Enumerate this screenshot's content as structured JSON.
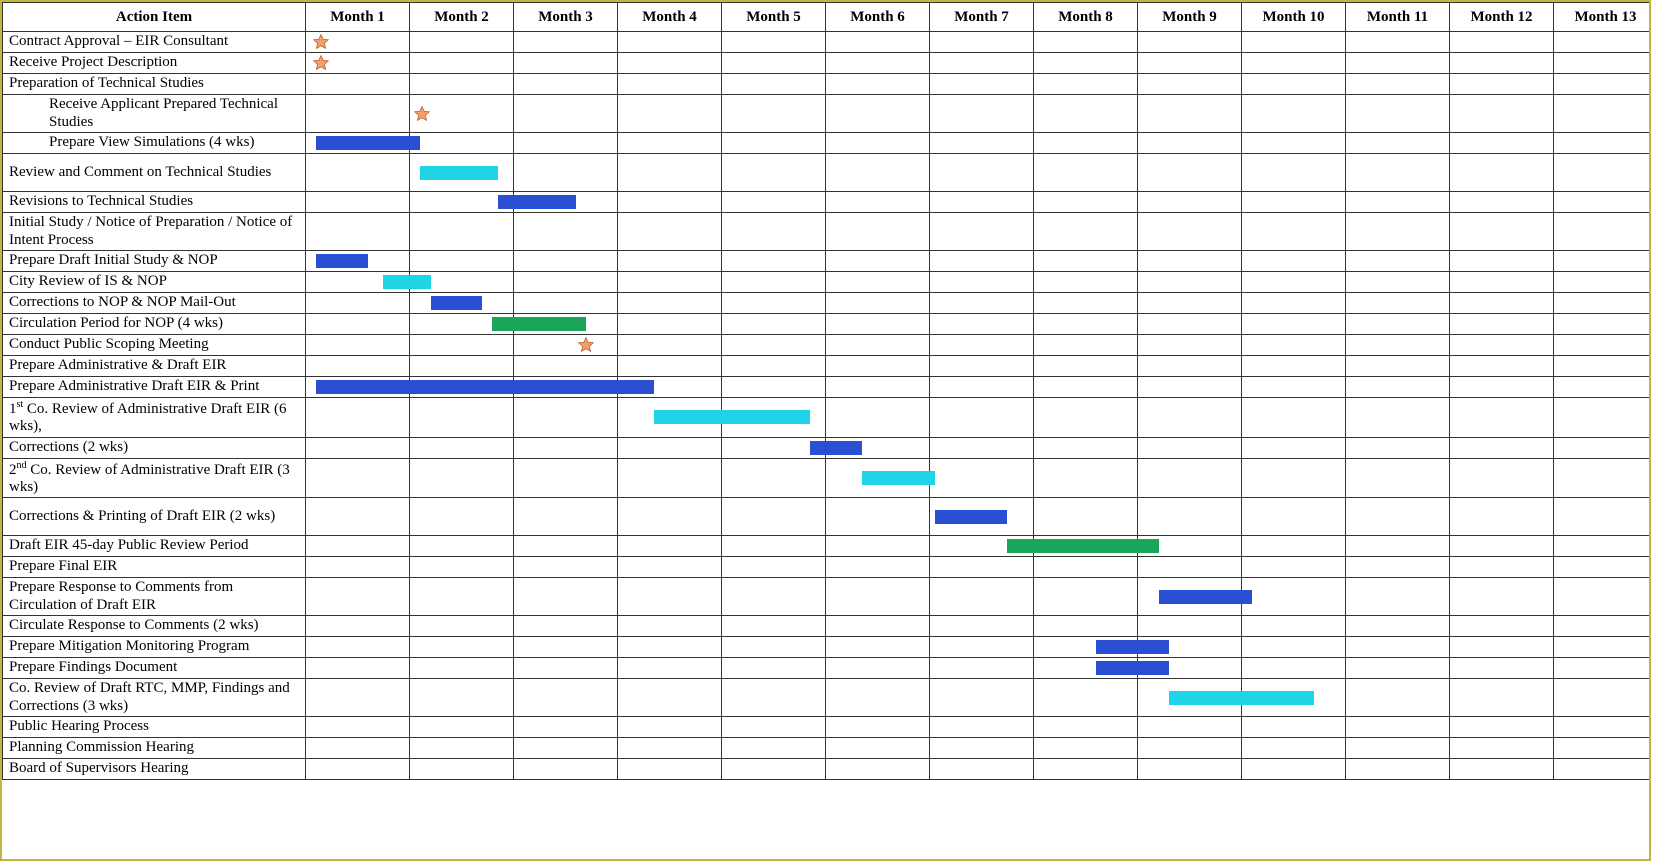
{
  "header": {
    "action": "Action Item",
    "months": [
      "Month 1",
      "Month 2",
      "Month 3",
      "Month 4",
      "Month 5",
      "Month 6",
      "Month 7",
      "Month 8",
      "Month 9",
      "Month 10",
      "Month 11",
      "Month 12",
      "Month 13"
    ]
  },
  "rows": [
    {
      "label": "Contract Approval – EIR Consultant",
      "h": 1,
      "marks": [
        {
          "type": "star",
          "col": 0,
          "pos": 0.15
        }
      ]
    },
    {
      "label": "Receive Project Description",
      "h": 1,
      "marks": [
        {
          "type": "star",
          "col": 0,
          "pos": 0.15
        }
      ]
    },
    {
      "label": "Preparation of Technical Studies",
      "h": 1,
      "marks": []
    },
    {
      "label": "Receive Applicant Prepared Technical Studies",
      "indent": true,
      "h": 2,
      "marks": [
        {
          "type": "star",
          "col": 1,
          "pos": 0.12
        }
      ]
    },
    {
      "label": "Prepare View Simulations (4 wks)",
      "indent": true,
      "h": 1,
      "marks": [
        {
          "type": "bar",
          "color": "blue",
          "startCol": 0,
          "startFrac": 0.1,
          "endCol": 1,
          "endFrac": 0.1
        }
      ]
    },
    {
      "label": "Review and Comment on Technical Studies",
      "h": 2,
      "marks": [
        {
          "type": "bar",
          "color": "cyan",
          "startCol": 1,
          "startFrac": 0.1,
          "endCol": 1,
          "endFrac": 0.85
        }
      ]
    },
    {
      "label": "Revisions to Technical Studies",
      "h": 1,
      "marks": [
        {
          "type": "bar",
          "color": "blue",
          "startCol": 1,
          "startFrac": 0.85,
          "endCol": 2,
          "endFrac": 0.6
        }
      ]
    },
    {
      "label": "Initial Study / Notice of Preparation / Notice of Intent Process",
      "h": 2,
      "marks": []
    },
    {
      "label": "Prepare Draft Initial Study & NOP",
      "h": 1,
      "marks": [
        {
          "type": "bar",
          "color": "blue",
          "startCol": 0,
          "startFrac": 0.1,
          "endCol": 0,
          "endFrac": 0.6
        }
      ]
    },
    {
      "label": "City Review of IS & NOP",
      "h": 1,
      "marks": [
        {
          "type": "bar",
          "color": "cyan",
          "startCol": 0,
          "startFrac": 0.75,
          "endCol": 1,
          "endFrac": 0.2
        }
      ]
    },
    {
      "label": "Corrections to NOP & NOP Mail-Out",
      "h": 1,
      "marks": [
        {
          "type": "bar",
          "color": "blue",
          "startCol": 1,
          "startFrac": 0.2,
          "endCol": 1,
          "endFrac": 0.7
        }
      ]
    },
    {
      "label": "Circulation Period for NOP  (4 wks)",
      "h": 1,
      "marks": [
        {
          "type": "bar",
          "color": "green",
          "startCol": 1,
          "startFrac": 0.8,
          "endCol": 2,
          "endFrac": 0.7
        }
      ]
    },
    {
      "label": "Conduct Public Scoping Meeting",
      "h": 1,
      "marks": [
        {
          "type": "star",
          "col": 2,
          "pos": 0.7
        }
      ]
    },
    {
      "label": "Prepare Administrative & Draft EIR",
      "h": 1,
      "marks": []
    },
    {
      "label": "Prepare Administrative Draft EIR & Print",
      "h": 1,
      "marks": [
        {
          "type": "bar",
          "color": "blue",
          "startCol": 0,
          "startFrac": 0.1,
          "endCol": 3,
          "endFrac": 0.35
        }
      ]
    },
    {
      "label": "1<sup>st</sup> Co. Review of Administrative Draft EIR (6 wks),",
      "h": 2,
      "html": true,
      "marks": [
        {
          "type": "bar",
          "color": "cyan",
          "startCol": 3,
          "startFrac": 0.35,
          "endCol": 4,
          "endFrac": 0.85
        }
      ]
    },
    {
      "label": "Corrections (2 wks)",
      "h": 1,
      "marks": [
        {
          "type": "bar",
          "color": "blue",
          "startCol": 4,
          "startFrac": 0.85,
          "endCol": 5,
          "endFrac": 0.35
        }
      ]
    },
    {
      "label": "2<sup>nd</sup> Co. Review of Administrative Draft EIR (3 wks)",
      "h": 2,
      "html": true,
      "marks": [
        {
          "type": "bar",
          "color": "cyan",
          "startCol": 5,
          "startFrac": 0.35,
          "endCol": 6,
          "endFrac": 0.05
        }
      ]
    },
    {
      "label": "Corrections & Printing of Draft EIR (2 wks)",
      "h": 2,
      "marks": [
        {
          "type": "bar",
          "color": "blue",
          "startCol": 6,
          "startFrac": 0.05,
          "endCol": 6,
          "endFrac": 0.75
        }
      ]
    },
    {
      "label": "Draft EIR 45-day Public Review Period",
      "h": 1,
      "marks": [
        {
          "type": "bar",
          "color": "green",
          "startCol": 6,
          "startFrac": 0.75,
          "endCol": 8,
          "endFrac": 0.2
        }
      ]
    },
    {
      "label": "Prepare Final EIR",
      "h": 1,
      "marks": []
    },
    {
      "label": "Prepare Response to Comments from Circulation of Draft EIR",
      "h": 2,
      "marks": [
        {
          "type": "bar",
          "color": "blue",
          "startCol": 8,
          "startFrac": 0.2,
          "endCol": 9,
          "endFrac": 0.1
        }
      ]
    },
    {
      "label": "Circulate Response to Comments (2 wks)",
      "h": 1,
      "marks": []
    },
    {
      "label": "Prepare Mitigation Monitoring Program",
      "h": 1,
      "marks": [
        {
          "type": "bar",
          "color": "blue",
          "startCol": 7,
          "startFrac": 0.6,
          "endCol": 8,
          "endFrac": 0.3
        }
      ]
    },
    {
      "label": "Prepare Findings Document",
      "h": 1,
      "marks": [
        {
          "type": "bar",
          "color": "blue",
          "startCol": 7,
          "startFrac": 0.6,
          "endCol": 8,
          "endFrac": 0.3
        }
      ]
    },
    {
      "label": "Co. Review of Draft RTC, MMP, Findings and Corrections (3 wks)",
      "h": 2,
      "marks": [
        {
          "type": "bar",
          "color": "cyan",
          "startCol": 8,
          "startFrac": 0.3,
          "endCol": 9,
          "endFrac": 0.7
        }
      ]
    },
    {
      "label": "Public Hearing Process",
      "h": 1,
      "marks": []
    },
    {
      "label": "Planning Commission Hearing",
      "h": 1,
      "marks": []
    },
    {
      "label": "Board of Supervisors Hearing",
      "h": 1,
      "marks": []
    }
  ],
  "colors": {
    "blue": "#2a4fd0",
    "cyan": "#1ed4e6",
    "green": "#1aa65a",
    "starFill": "#f2a06a",
    "starStroke": "#b85c2e"
  },
  "chart_data": {
    "type": "gantt",
    "columns": 13,
    "unit": "month",
    "legend": {
      "blue": "task",
      "cyan": "review",
      "green": "public/circulation",
      "star": "milestone"
    },
    "tasks": [
      {
        "name": "Contract Approval – EIR Consultant",
        "milestone": 0.15
      },
      {
        "name": "Receive Project Description",
        "milestone": 0.15
      },
      {
        "name": "Receive Applicant Prepared Technical Studies",
        "milestone": 1.12
      },
      {
        "name": "Prepare View Simulations (4 wks)",
        "start": 0.1,
        "end": 1.1,
        "kind": "task"
      },
      {
        "name": "Review and Comment on Technical Studies",
        "start": 1.1,
        "end": 1.85,
        "kind": "review"
      },
      {
        "name": "Revisions to Technical Studies",
        "start": 1.85,
        "end": 2.6,
        "kind": "task"
      },
      {
        "name": "Prepare Draft Initial Study & NOP",
        "start": 0.1,
        "end": 0.6,
        "kind": "task"
      },
      {
        "name": "City Review of IS & NOP",
        "start": 0.75,
        "end": 1.2,
        "kind": "review"
      },
      {
        "name": "Corrections to NOP & NOP Mail-Out",
        "start": 1.2,
        "end": 1.7,
        "kind": "task"
      },
      {
        "name": "Circulation Period for NOP (4 wks)",
        "start": 1.8,
        "end": 2.7,
        "kind": "public"
      },
      {
        "name": "Conduct Public Scoping Meeting",
        "milestone": 2.7
      },
      {
        "name": "Prepare Administrative Draft EIR & Print",
        "start": 0.1,
        "end": 3.35,
        "kind": "task"
      },
      {
        "name": "1st Co. Review of Administrative Draft EIR (6 wks)",
        "start": 3.35,
        "end": 4.85,
        "kind": "review"
      },
      {
        "name": "Corrections (2 wks)",
        "start": 4.85,
        "end": 5.35,
        "kind": "task"
      },
      {
        "name": "2nd Co. Review of Administrative Draft EIR (3 wks)",
        "start": 5.35,
        "end": 6.05,
        "kind": "review"
      },
      {
        "name": "Corrections & Printing of Draft EIR (2 wks)",
        "start": 6.05,
        "end": 6.75,
        "kind": "task"
      },
      {
        "name": "Draft EIR 45-day Public Review Period",
        "start": 6.75,
        "end": 8.2,
        "kind": "public"
      },
      {
        "name": "Prepare Response to Comments from Circulation of Draft EIR",
        "start": 8.2,
        "end": 9.1,
        "kind": "task"
      },
      {
        "name": "Prepare Mitigation Monitoring Program",
        "start": 7.6,
        "end": 8.3,
        "kind": "task"
      },
      {
        "name": "Prepare Findings Document",
        "start": 7.6,
        "end": 8.3,
        "kind": "task"
      },
      {
        "name": "Co. Review of Draft RTC, MMP, Findings and Corrections (3 wks)",
        "start": 8.3,
        "end": 9.7,
        "kind": "review"
      }
    ]
  }
}
